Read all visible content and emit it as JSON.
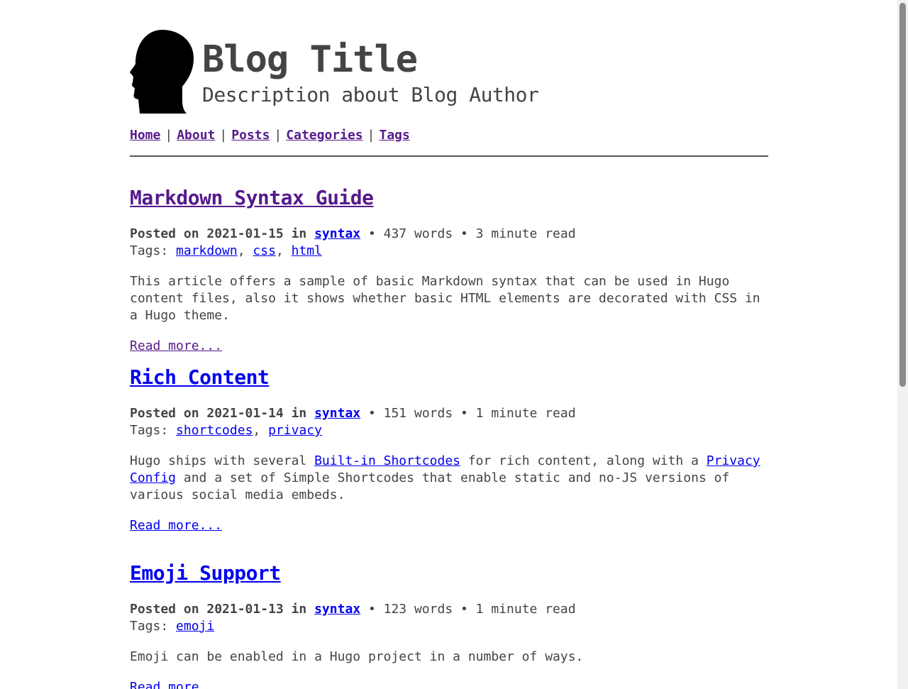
{
  "header": {
    "title": "Blog Title",
    "description": "Description about Blog Author"
  },
  "nav": {
    "items": [
      "Home",
      "About",
      "Posts",
      "Categories",
      "Tags"
    ],
    "separator": "|"
  },
  "posts": [
    {
      "title": "Markdown Syntax Guide",
      "posted_prefix": "Posted on 2021-01-15 in",
      "category": "syntax",
      "stats": " • 437 words • 3 minute read",
      "tags_label": "Tags:",
      "tags": [
        "markdown",
        "css",
        "html"
      ],
      "summary": "This article offers a sample of basic Markdown syntax that can be used in Hugo content files, also it shows whether basic HTML elements are decorated with CSS in a Hugo theme.",
      "read_more": "Read more..."
    },
    {
      "title": "Rich Content",
      "posted_prefix": "Posted on 2021-01-14 in",
      "category": "syntax",
      "stats": " • 151 words • 1 minute read",
      "tags_label": "Tags:",
      "tags": [
        "shortcodes",
        "privacy"
      ],
      "summary_parts": {
        "p1": "Hugo ships with several ",
        "link1": "Built-in Shortcodes",
        "p2": " for rich content, along with a ",
        "link2": "Privacy Config",
        "p3": " and a set of Simple Shortcodes that enable static and no-JS versions of various social media embeds."
      },
      "read_more": "Read more..."
    },
    {
      "title": "Emoji Support",
      "posted_prefix": "Posted on 2021-01-13 in",
      "category": "syntax",
      "stats": " • 123 words • 1 minute read",
      "tags_label": "Tags:",
      "tags": [
        "emoji"
      ],
      "summary": "Emoji can be enabled in a Hugo project in a number of ways.",
      "read_more": "Read more..."
    }
  ],
  "colors": {
    "text": "#444444",
    "link": "#0000ee",
    "visited": "#551a8b"
  }
}
